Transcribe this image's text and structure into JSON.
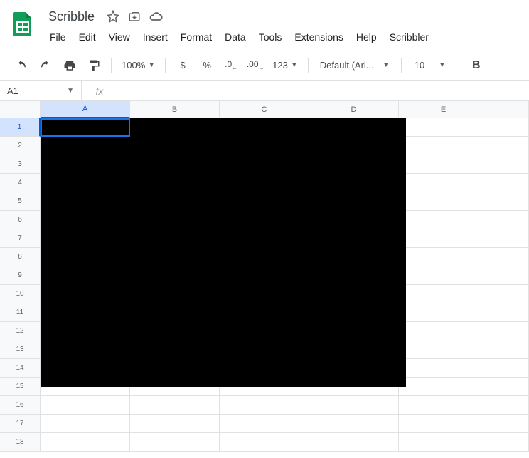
{
  "doc_title": "Scribble",
  "menus": [
    "File",
    "Edit",
    "View",
    "Insert",
    "Format",
    "Data",
    "Tools",
    "Extensions",
    "Help",
    "Scribbler"
  ],
  "toolbar": {
    "zoom": "100%",
    "font": "Default (Ari...",
    "font_size": "10",
    "currency_symbol": "$",
    "percent_symbol": "%",
    "decrease_decimal": ".0",
    "increase_decimal": ".00",
    "format_123": "123",
    "bold": "B"
  },
  "name_box": "A1",
  "fx_label": "fx",
  "columns": [
    "A",
    "B",
    "C",
    "D",
    "E"
  ],
  "rows": [
    1,
    2,
    3,
    4,
    5,
    6,
    7,
    8,
    9,
    10,
    11,
    12,
    13,
    14,
    15,
    16,
    17,
    18
  ],
  "selected_cell": {
    "row": 1,
    "col": "A"
  },
  "overlay": {
    "top_row": 1,
    "bottom_row": 15,
    "left_col": "A",
    "right_col": "D"
  }
}
